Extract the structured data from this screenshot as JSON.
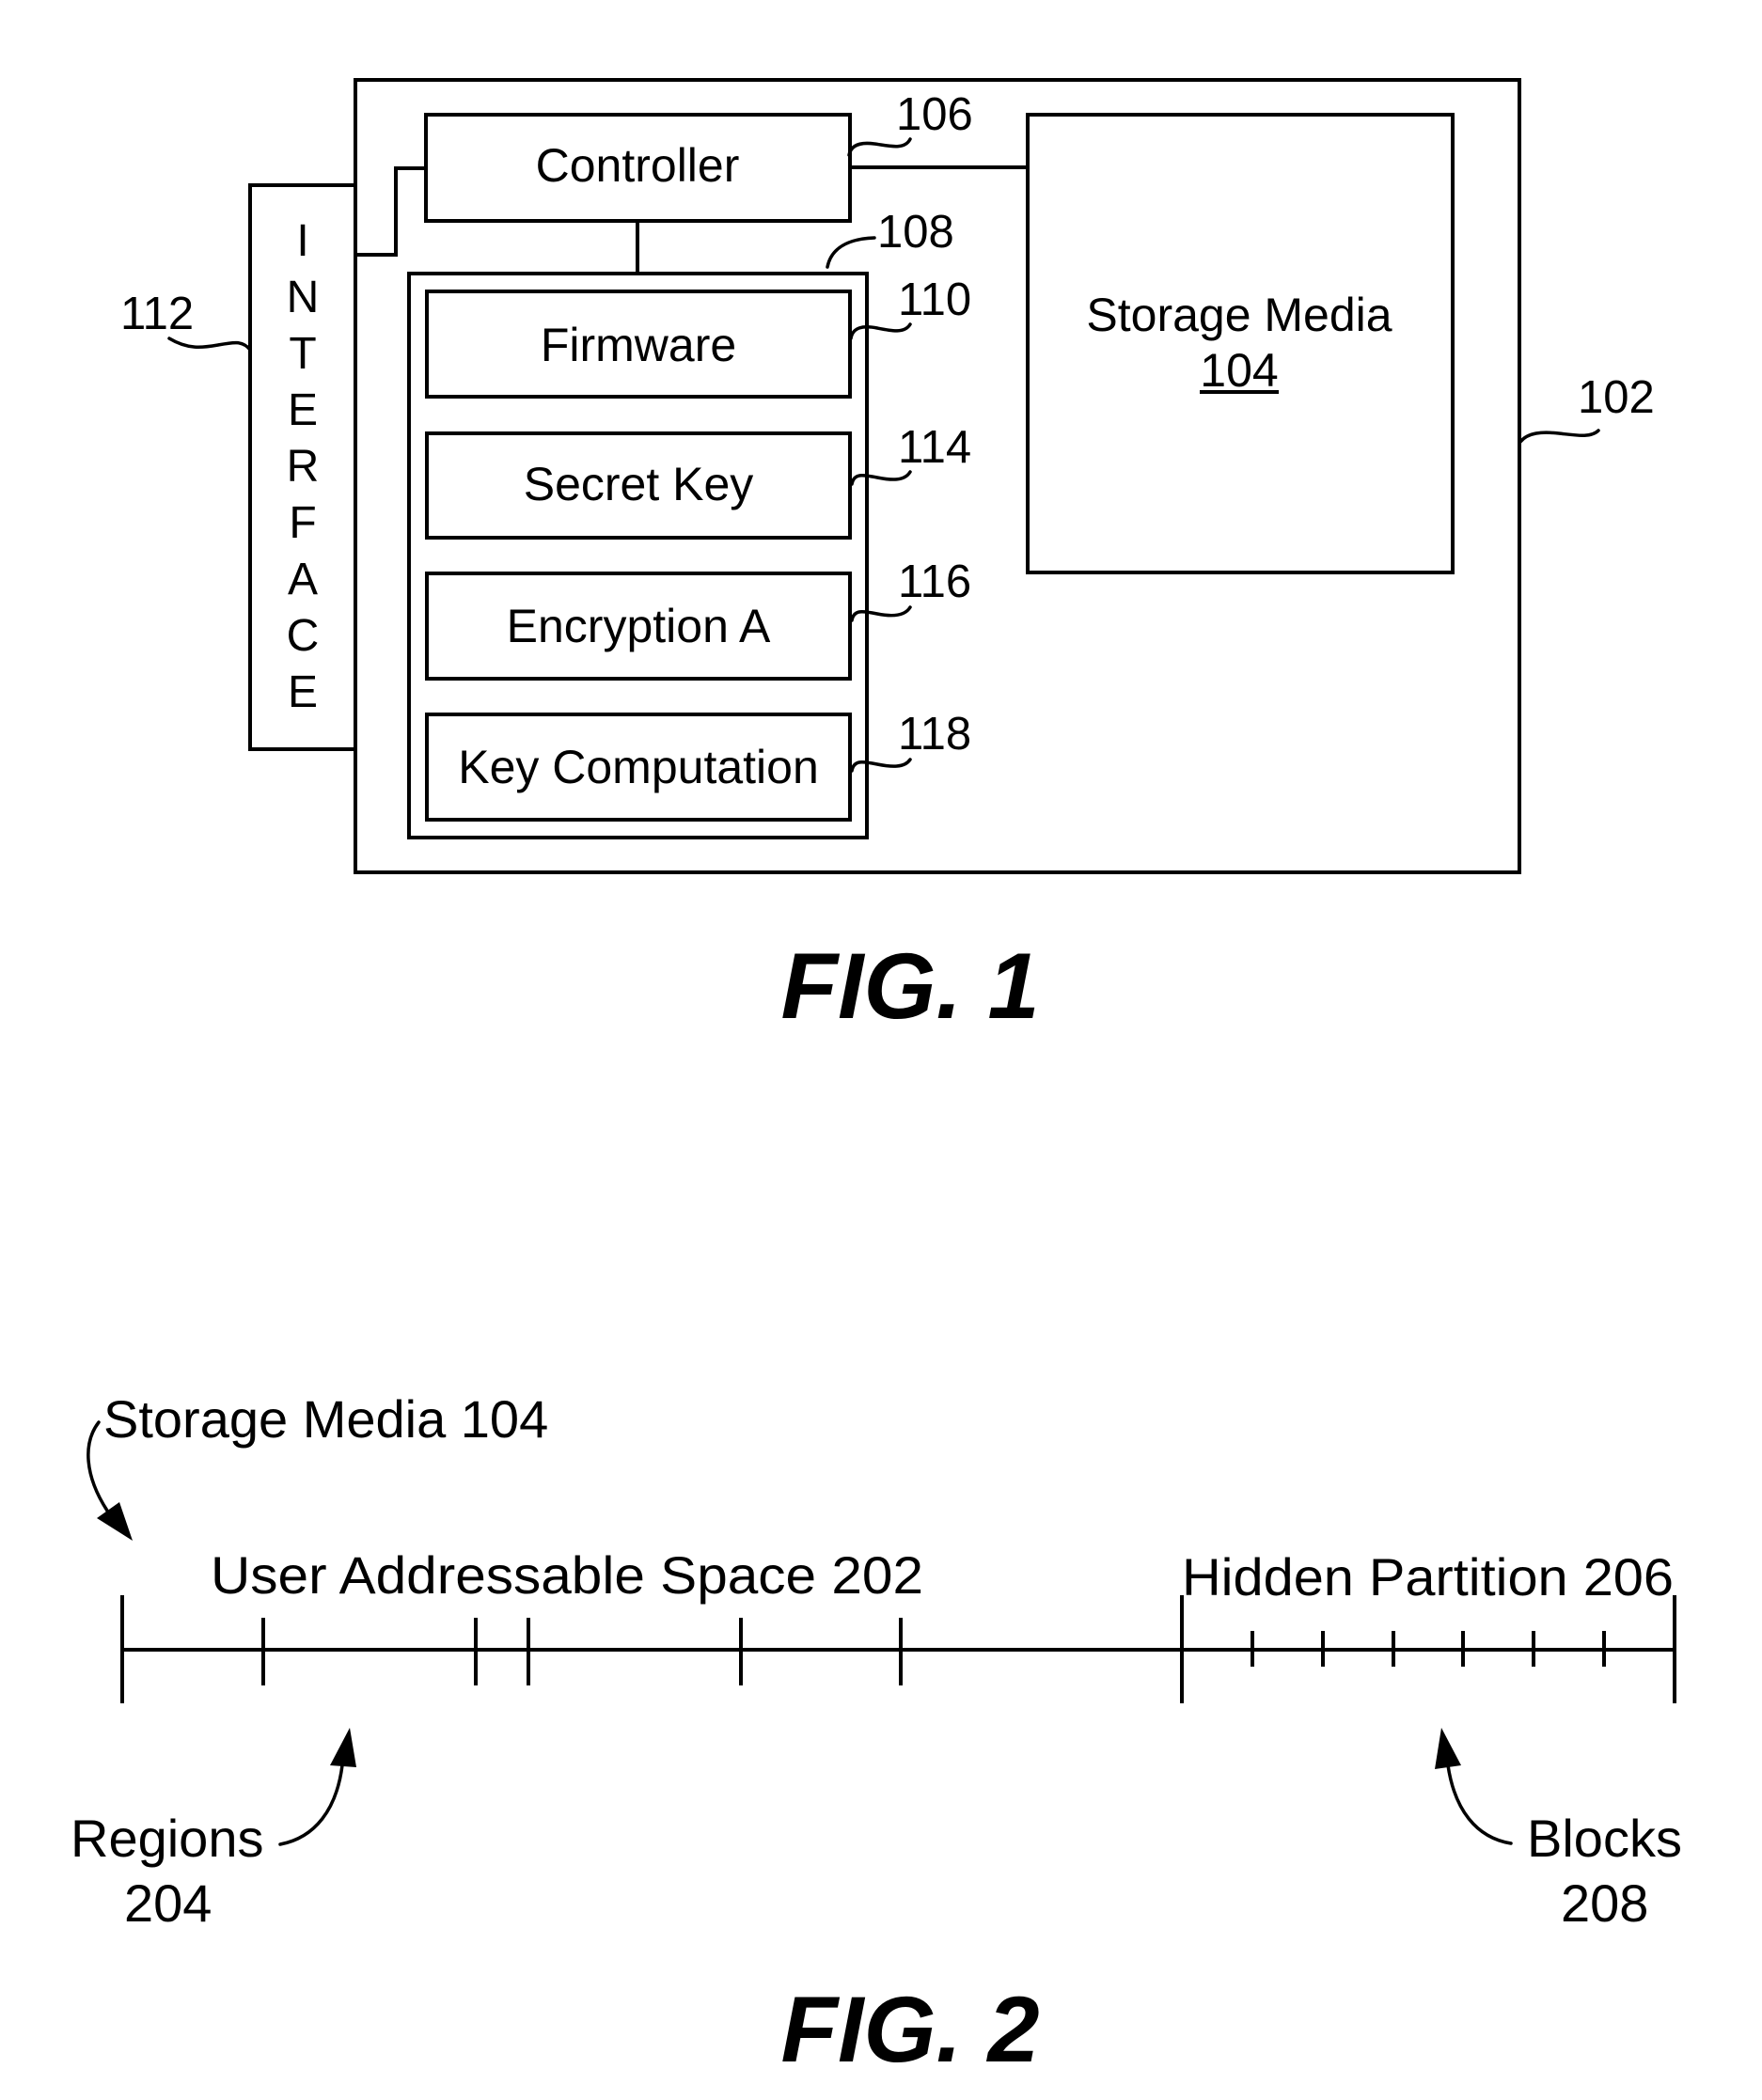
{
  "figure1": {
    "title": "FIG. 1",
    "device": {
      "ref": "102"
    },
    "interface": {
      "ref": "112",
      "letters": [
        "I",
        "N",
        "T",
        "E",
        "R",
        "F",
        "A",
        "C",
        "E"
      ]
    },
    "controller": {
      "label": "Controller",
      "ref": "106"
    },
    "memory": {
      "ref": "108",
      "modules": [
        {
          "label": "Firmware",
          "ref": "110"
        },
        {
          "label": "Secret Key",
          "ref": "114"
        },
        {
          "label": "Encryption A",
          "ref": "116"
        },
        {
          "label": "Key Computation",
          "ref": "118"
        }
      ]
    },
    "storage_media": {
      "label": "Storage Media",
      "ref": "104"
    }
  },
  "figure2": {
    "title": "FIG. 2",
    "storage_media_label": "Storage Media 104",
    "user_space_label": "User Addressable Space 202",
    "hidden_partition_label": "Hidden Partition 206",
    "regions_label": {
      "line1": "Regions",
      "line2": "204"
    },
    "blocks_label": {
      "line1": "Blocks",
      "line2": "208"
    },
    "user_space_region_boundaries": 6,
    "hidden_partition_blocks": 7
  }
}
